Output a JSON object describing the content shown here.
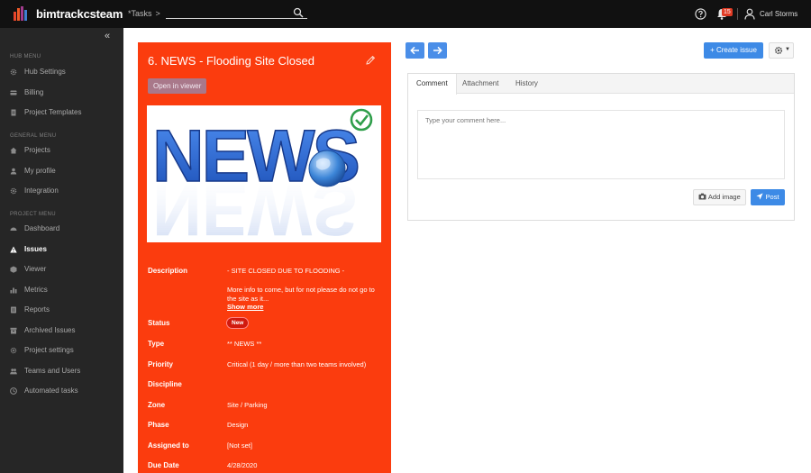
{
  "app": {
    "name": "bimtrackcsteam"
  },
  "topbar": {
    "breadcrumb": "*Tasks",
    "breadcrumb_chevron": ">",
    "search_placeholder": "",
    "notifications_count": "15",
    "user_name": "Carl Storms"
  },
  "sidebar": {
    "collapse_glyph": "«",
    "sections": [
      {
        "label": "Hub Menu",
        "items": [
          {
            "label": "Hub Settings",
            "icon": "gear-icon"
          },
          {
            "label": "Billing",
            "icon": "card-icon"
          },
          {
            "label": "Project Templates",
            "icon": "document-icon"
          }
        ]
      },
      {
        "label": "General Menu",
        "items": [
          {
            "label": "Projects",
            "icon": "home-icon"
          },
          {
            "label": "My profile",
            "icon": "user-icon"
          },
          {
            "label": "Integration",
            "icon": "gear-icon"
          }
        ]
      },
      {
        "label": "Project Menu",
        "items": [
          {
            "label": "Dashboard",
            "icon": "dashboard-icon"
          },
          {
            "label": "Issues",
            "icon": "warning-icon",
            "active": true
          },
          {
            "label": "Viewer",
            "icon": "cube-icon"
          },
          {
            "label": "Metrics",
            "icon": "chart-icon"
          },
          {
            "label": "Reports",
            "icon": "report-icon"
          },
          {
            "label": "Archived Issues",
            "icon": "archive-icon"
          },
          {
            "label": "Project settings",
            "icon": "gear-icon"
          },
          {
            "label": "Teams and Users",
            "icon": "users-icon"
          },
          {
            "label": "Automated tasks",
            "icon": "clock-icon"
          }
        ]
      }
    ]
  },
  "issue": {
    "title": "6. NEWS - Flooding Site Closed",
    "open_in_viewer": "Open in viewer",
    "image_word": "NEWS",
    "fields": {
      "description_label": "Description",
      "description_line1": "- SITE CLOSED DUE TO FLOODING -",
      "description_line2": "More info to come, but for not please do not go to the site as it...",
      "show_more": "Show more",
      "status_label": "Status",
      "status_value": "New",
      "type_label": "Type",
      "type_value": "** NEWS **",
      "priority_label": "Priority",
      "priority_value": "Critical (1 day / more than two teams involved)",
      "discipline_label": "Discipline",
      "discipline_value": "",
      "zone_label": "Zone",
      "zone_value": "Site / Parking",
      "phase_label": "Phase",
      "phase_value": "Design",
      "assigned_label": "Assigned to",
      "assigned_value": "[Not set]",
      "due_label": "Due Date",
      "due_value": "4/28/2020"
    }
  },
  "toolbar": {
    "create_issue": "+ Create issue"
  },
  "comments": {
    "tabs": [
      "Comment",
      "Attachment",
      "History"
    ],
    "placeholder": "Type your comment here...",
    "add_image": "Add image",
    "post": "Post"
  },
  "colors": {
    "panel": "#fb3c0e",
    "accent": "#3d8ae6",
    "sidebar": "#262626",
    "topbar": "#111111"
  }
}
